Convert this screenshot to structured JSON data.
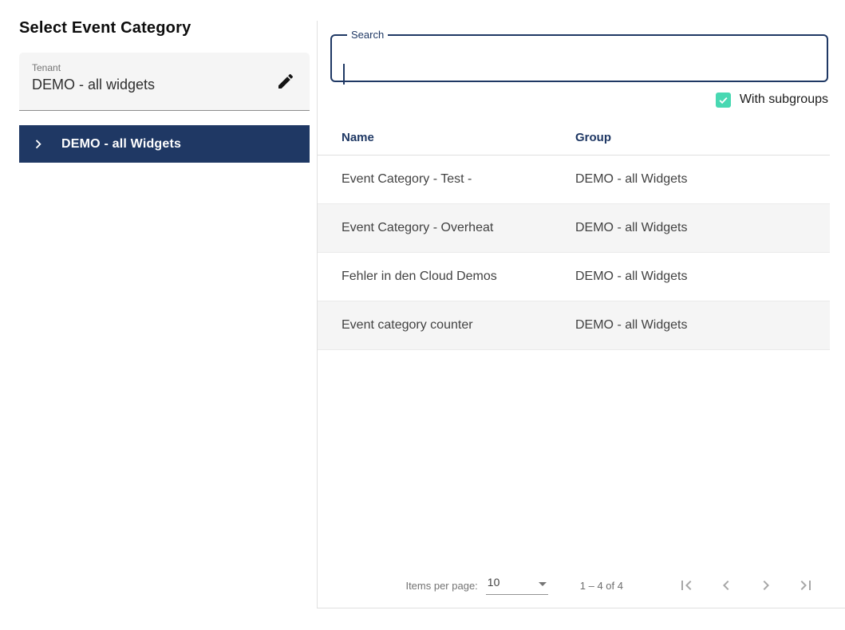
{
  "colors": {
    "primary_navy": "#1f3864",
    "accent_teal": "#48d8b2",
    "row_alt_bg": "#f5f5f5",
    "divider": "#e0e0e0",
    "selected_item_bg": "#1f3864"
  },
  "left_panel": {
    "title": "Select Event Category",
    "tenant_field": {
      "label": "Tenant",
      "value": "DEMO - all widgets"
    },
    "group_tree": {
      "selected_item": "DEMO - all Widgets"
    }
  },
  "right_panel": {
    "search": {
      "label": "Search",
      "value": "",
      "placeholder": ""
    },
    "subgroups_checkbox": {
      "label": "With subgroups",
      "checked": true
    },
    "table": {
      "headers": {
        "name": "Name",
        "group": "Group"
      },
      "rows": [
        {
          "name": "Event Category - Test -",
          "group": "DEMO - all Widgets"
        },
        {
          "name": "Event Category - Overheat",
          "group": "DEMO - all Widgets"
        },
        {
          "name": "Fehler in den Cloud Demos",
          "group": "DEMO - all Widgets"
        },
        {
          "name": "Event category counter",
          "group": "DEMO - all Widgets"
        }
      ]
    },
    "paginator": {
      "items_per_page_label": "Items per page:",
      "page_size": "10",
      "range_label": "1 – 4 of 4",
      "nav_icons": [
        "first-page-icon",
        "previous-page-icon",
        "next-page-icon",
        "last-page-icon"
      ]
    }
  }
}
